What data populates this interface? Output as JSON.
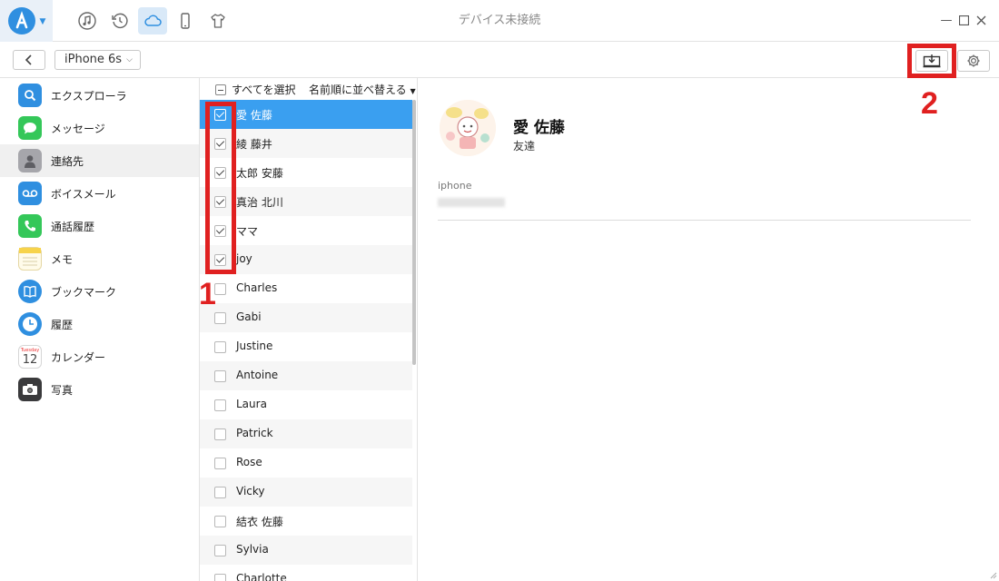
{
  "window": {
    "title": "デバイス未接続",
    "logo_letter": "a"
  },
  "top_nav": [
    {
      "name": "music-icon"
    },
    {
      "name": "restore-icon"
    },
    {
      "name": "cloud-icon",
      "active": true
    },
    {
      "name": "phone-icon"
    },
    {
      "name": "shirt-icon"
    }
  ],
  "toolbar": {
    "device": "iPhone 6s"
  },
  "sidebar": {
    "items": [
      {
        "label": "エクスプローラ",
        "icon": "search-icon",
        "color": "#2f8fe0"
      },
      {
        "label": "メッセージ",
        "icon": "message-icon",
        "color": "#34c759"
      },
      {
        "label": "連絡先",
        "icon": "contacts-icon",
        "color": "#8e8e93"
      },
      {
        "label": "ボイスメール",
        "icon": "voicemail-icon",
        "color": "#2f8fe0"
      },
      {
        "label": "通話履歴",
        "icon": "phone-call-icon",
        "color": "#34c759"
      },
      {
        "label": "メモ",
        "icon": "notes-icon",
        "color": "#f7d34a"
      },
      {
        "label": "ブックマーク",
        "icon": "bookmark-icon",
        "color": "#2f8fe0"
      },
      {
        "label": "履歴",
        "icon": "clock-icon",
        "color": "#2f8fe0"
      },
      {
        "label": "カレンダー",
        "icon": "calendar-icon",
        "color": "#ffffff"
      },
      {
        "label": "写真",
        "icon": "camera-icon",
        "color": "#3a3a3c"
      }
    ],
    "calendar_day": "Tuesday",
    "calendar_date": "12"
  },
  "contact_list": {
    "select_all": "すべてを選択",
    "sort": "名前順に並べ替える",
    "contacts": [
      {
        "name": "愛 佐藤",
        "checked": true,
        "selected": true
      },
      {
        "name": "綾 藤井",
        "checked": true
      },
      {
        "name": "太郎 安藤",
        "checked": true
      },
      {
        "name": "真治 北川",
        "checked": true
      },
      {
        "name": "ママ",
        "checked": true
      },
      {
        "name": "joy",
        "checked": true
      },
      {
        "name": "Charles",
        "checked": false
      },
      {
        "name": "Gabi",
        "checked": false
      },
      {
        "name": "Justine",
        "checked": false
      },
      {
        "name": "Antoine",
        "checked": false
      },
      {
        "name": "Laura",
        "checked": false
      },
      {
        "name": "Patrick",
        "checked": false
      },
      {
        "name": "Rose",
        "checked": false
      },
      {
        "name": "Vicky",
        "checked": false
      },
      {
        "name": "結衣 佐藤",
        "checked": false
      },
      {
        "name": "Sylvia",
        "checked": false
      },
      {
        "name": "Charlotte",
        "checked": false
      }
    ]
  },
  "detail": {
    "name": "愛 佐藤",
    "group": "友達",
    "field_label": "iphone"
  },
  "annotations": {
    "label_1": "1",
    "label_2": "2",
    "color": "#e02020"
  }
}
